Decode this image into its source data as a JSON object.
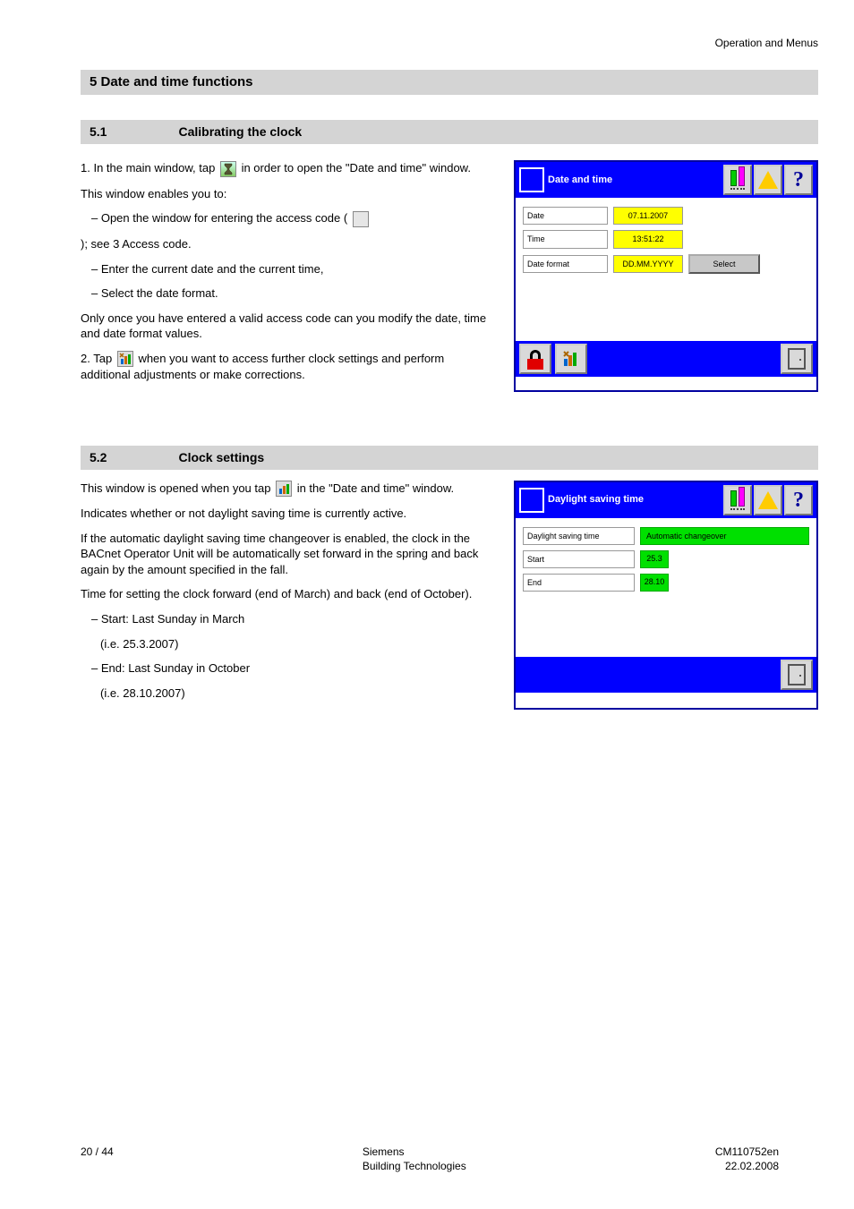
{
  "header": {
    "doc_title": "Operation and Menus"
  },
  "section1": {
    "title": "5 Date and time functions",
    "subtitle_left": "5.1",
    "subtitle_right": "Calibrating the clock",
    "step1_num": "1.",
    "step1_text_a": "In the main window, tap ",
    "step1_text_b": " in order to open the \"Date and time\" window.",
    "intro": "This window enables you to:",
    "bullet_a_pre": "Open the window for entering the access code (",
    "bullet_a_post": "); see 3 Access code.",
    "bullet_b": "Enter the current date and the current time,",
    "bullet_c": "Select the date format.",
    "after_bullets": "Only once you have entered a valid access code can you modify the date, time and date format values.",
    "step2_num": "2.",
    "step2_pre": "Tap ",
    "step2_post": " when you want to access further clock settings and perform additional adjustments or make corrections.",
    "panel": {
      "title": "Date and time",
      "row1_label": "Date",
      "row1_value": "07.11.2007",
      "row2_label": "Time",
      "row2_value": "13:51:22",
      "row3_label": "Date format",
      "row3_value": "DD.MM.YYYY",
      "select_btn": "Select"
    }
  },
  "section2": {
    "title_left": "5.2",
    "title_right": "Clock settings",
    "intro_pre": "This window is opened when you tap ",
    "intro_post": " in the \"Date and time\" window.",
    "para1": "Indicates whether or not daylight saving time is currently active.",
    "para2": "If the automatic daylight saving time changeover is enabled, the clock in the BACnet Operator Unit will be automatically set forward in the spring and back again by the amount specified in the fall.",
    "bullet_pre": "Time for setting the clock forward (end of March) and back (end of October).",
    "bullet_a_line1": "– Start: Last Sunday in March",
    "bullet_a_line2": "  (i.e. 25.3.2007)",
    "bullet_b_line1": "– End: Last Sunday in October",
    "bullet_b_line2": "  (i.e. 28.10.2007)",
    "panel": {
      "title": "Daylight saving time",
      "row1_label": "Daylight saving time",
      "row1_value": "Automatic changeover",
      "row2_label": "Start",
      "row2_value": "25.3",
      "row3_label": "End",
      "row3_value": "28.10"
    }
  },
  "footer": {
    "left": "20 / 44",
    "center_a": "Siemens",
    "center_b": "Building Technologies",
    "right": "CM110752en",
    "date": "22.02.2008"
  },
  "icons": {
    "hourglass": "hourglass-icon",
    "lock": "padlock-icon",
    "tools": "tools-icon",
    "bars": "bars-icon",
    "warn": "warning-icon",
    "help": "help-icon",
    "exit": "exit-door-icon"
  }
}
